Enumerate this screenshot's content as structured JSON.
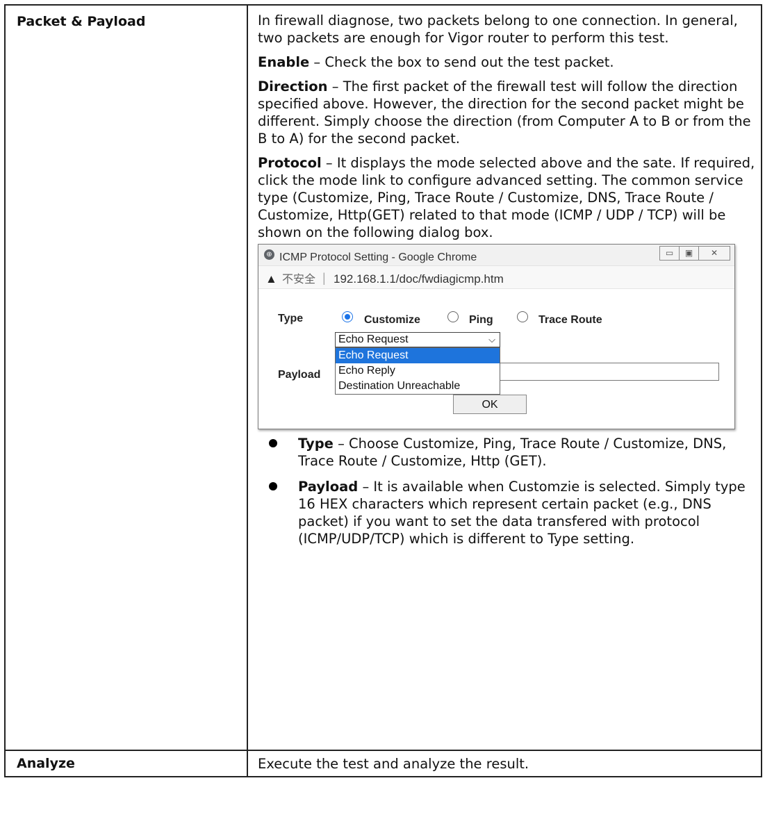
{
  "rows": [
    {
      "title": "Packet & Payload",
      "intro": "In firewall diagnose, two packets belong to one connection. In general, two packets are enough for Vigor router to perform this test.",
      "enable_term": "Enable",
      "enable_text": " – Check the box to send out the test packet.",
      "direction_term": "Direction",
      "direction_text": " – The first packet of the firewall test will follow the direction specified above. However, the direction for the second packet might be different. Simply choose the direction (from Computer A to B or from the B to A) for the second packet.",
      "protocol_term": "Protocol",
      "protocol_text": " – It displays the mode selected above and the sate. If required, click the mode link to configure advanced setting. The common service type (Customize, Ping, Trace Route / Customize, DNS, Trace Route / Customize, Http(GET) related to that mode (ICMP / UDP / TCP) will be shown on the following dialog box."
    },
    {
      "title": "Analyze",
      "text": "Execute the test and analyze the result."
    }
  ],
  "dialog": {
    "window_title": "ICMP Protocol Setting - Google Chrome",
    "insecure_label": "不安全",
    "url": "192.168.1.1/doc/fwdiagicmp.htm",
    "type_label": "Type",
    "type_options": [
      "Customize",
      "Ping",
      "Trace Route"
    ],
    "selected_type": "Customize",
    "select_value": "Echo Request",
    "dropdown_options": [
      "Echo Request",
      "Echo Reply",
      "Destination Unreachable"
    ],
    "highlighted_option": "Echo Request",
    "payload_label": "Payload",
    "ok_label": "OK"
  },
  "bullets": [
    {
      "term": "Type",
      "text": " – Choose Customize, Ping, Trace Route / Customize, DNS, Trace Route / Customize, Http (GET)."
    },
    {
      "term": "Payload",
      "text": " – It is available when Customzie is selected. Simply type 16 HEX characters which represent certain packet (e.g., DNS packet) if you want to set the data transfered with protocol (ICMP/UDP/TCP) which is different to Type setting."
    }
  ]
}
